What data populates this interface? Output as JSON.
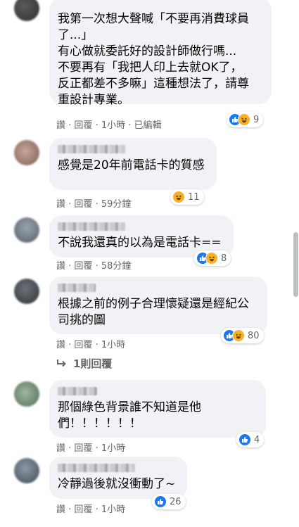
{
  "comments": [
    {
      "text": "我第一次想大聲喊「不要再消費球員了...」\n有心做就委託好的設計師做行嗎...\n不要再有「我把人印上去就OK了，反正都差不多嘛」這種想法了，請尊重設計專業。",
      "text_lines": [
        "我第一次想大聲喊「不要再消費球員",
        "了...」",
        "有心做就委託好的設計師做行嗎...",
        "不要再有「我把人印上去就OK了，",
        "反正都差不多嘛」這種想法了，請尊",
        "重設計專業。"
      ],
      "like_label": "讚",
      "reply_label": "回覆",
      "time": "1小時",
      "edited": "已編輯",
      "reaction_count": "9",
      "reactions": [
        "like",
        "haha"
      ]
    },
    {
      "text": "感覺是20年前電話卡的質感",
      "like_label": "讚",
      "reply_label": "回覆",
      "time": "59分鐘",
      "reaction_count": "11",
      "reactions": [
        "haha"
      ]
    },
    {
      "text": "不說我還真的以為是電話卡==",
      "like_label": "讚",
      "reply_label": "回覆",
      "time": "58分鐘",
      "reaction_count": "8",
      "reactions": [
        "like",
        "haha"
      ]
    },
    {
      "text": "根據之前的例子合理懷疑還是經紀公司挑的圖",
      "text_lines": [
        "根據之前的例子合理懷疑還是經紀公",
        "司挑的圖"
      ],
      "like_label": "讚",
      "reply_label": "回覆",
      "time": "1小時",
      "reaction_count": "80",
      "reactions": [
        "like",
        "haha"
      ],
      "replies_label": "1則回覆"
    },
    {
      "text": "那個綠色背景誰不知道是他們！！！！！！",
      "text_lines": [
        "那個綠色背景誰不知道是他",
        "們！！！！！！"
      ],
      "like_label": "讚",
      "reply_label": "回覆",
      "time": "1小時",
      "reaction_count": "4",
      "reactions": [
        "like"
      ]
    },
    {
      "text": "冷靜過後就沒衝動了~",
      "like_label": "讚",
      "reply_label": "回覆",
      "time": "1小時",
      "reaction_count": "26",
      "reactions": [
        "like"
      ]
    }
  ],
  "separator": " · ",
  "colors": {
    "bubble": "#f0f2f5",
    "meta_text": "#65676b",
    "like_blue": "#1877f2",
    "haha_yellow": "#f7b125"
  }
}
